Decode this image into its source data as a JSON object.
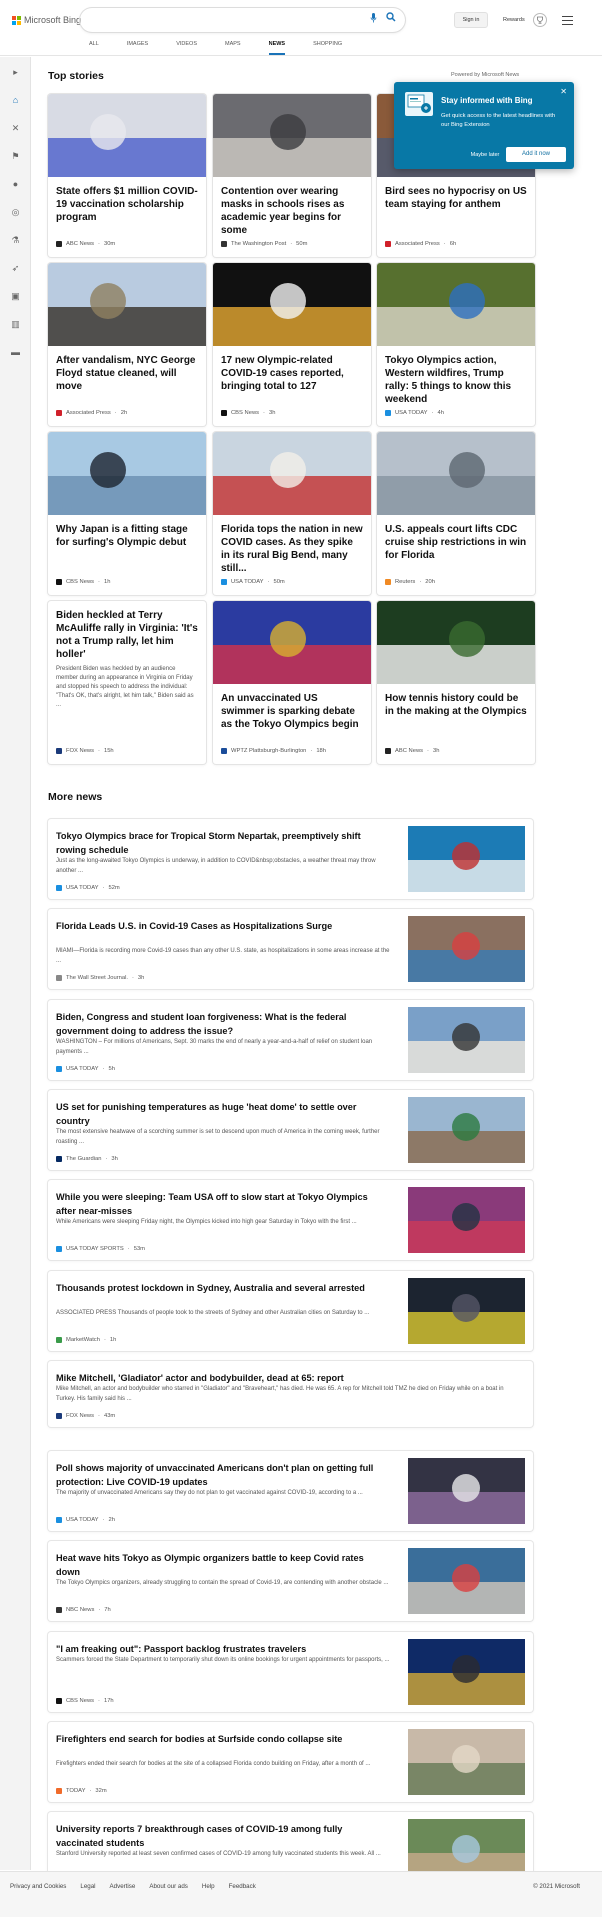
{
  "header": {
    "brand": "Microsoft Bing",
    "sign_in": "Sign in",
    "rewards": "Rewards",
    "tabs": [
      "ALL",
      "IMAGES",
      "VIDEOS",
      "MAPS",
      "NEWS",
      "SHOPPING"
    ],
    "active_tab": "NEWS"
  },
  "top_stories": {
    "heading": "Top stories",
    "powered_by": "Powered by Microsoft News",
    "cards": [
      {
        "title": "State offers $1 million COVID-19 vaccination scholarship program",
        "source": "ABC News",
        "time": "30m",
        "icon_color": "#222"
      },
      {
        "title": "Contention over wearing masks in schools rises as academic year begins for some",
        "source": "The Washington Post",
        "time": "50m",
        "icon_color": "#333"
      },
      {
        "title": "Bird sees no hypocrisy on US team staying for anthem",
        "source": "Associated Press",
        "time": "6h",
        "icon_color": "#d0202a"
      },
      {
        "title": "After vandalism, NYC George Floyd statue cleaned, will move",
        "source": "Associated Press",
        "time": "2h",
        "icon_color": "#d0202a"
      },
      {
        "title": "17 new Olympic-related COVID-19 cases reported, bringing total to 127",
        "source": "CBS News",
        "time": "3h",
        "icon_color": "#111"
      },
      {
        "title": "Tokyo Olympics action, Western wildfires, Trump rally: 5 things to know this weekend",
        "source": "USA TODAY",
        "time": "4h",
        "icon_color": "#1a8fe0"
      },
      {
        "title": "Why Japan is a fitting stage for surfing's Olympic debut",
        "source": "CBS News",
        "time": "1h",
        "icon_color": "#111"
      },
      {
        "title": "Florida tops the nation in new COVID cases. As they spike in its rural Big Bend, many still...",
        "source": "USA TODAY",
        "time": "50m",
        "icon_color": "#1a8fe0"
      },
      {
        "title": "U.S. appeals court lifts CDC cruise ship restrictions in win for Florida",
        "source": "Reuters",
        "time": "20h",
        "icon_color": "#f08a24"
      },
      {
        "title": "Biden heckled at Terry McAuliffe rally in Virginia: 'It's not a Trump rally, let him holler'",
        "description": "President Biden was heckled by an audience member during an appearance in Virginia on Friday and stopped his speech to address the individual: \"That's OK, that's alright, let him talk,\" Biden said as ...",
        "source": "FOX News",
        "time": "15h",
        "icon_color": "#1b3a7a"
      },
      {
        "title": "An unvaccinated US swimmer is sparking debate as the Tokyo Olympics begin",
        "source": "WPTZ Plattsburgh-Burlington",
        "time": "18h",
        "icon_color": "#1b4d9a"
      },
      {
        "title": "How tennis history could be in the making at the Olympics",
        "source": "ABC News",
        "time": "3h",
        "icon_color": "#222"
      }
    ]
  },
  "popup": {
    "title": "Stay informed with Bing",
    "description": "Get quick access to the latest headlines with our Bing Extension",
    "maybe_later": "Maybe later",
    "add_now": "Add it now"
  },
  "more_news": {
    "heading": "More news",
    "items": [
      {
        "title": "Tokyo Olympics brace for Tropical Storm Nepartak, preemptively shift rowing schedule",
        "description": "Just as the long-awaited Tokyo Olympics is underway, in addition to COVID&nbsp;obstacles, a weather threat may throw another ...",
        "source": "USA TODAY",
        "time": "52m",
        "icon_color": "#1a8fe0"
      },
      {
        "title": "Florida Leads U.S. in Covid-19 Cases as Hospitalizations Surge",
        "description": "MIAMI—Florida is recording more Covid-19 cases than any other U.S. state, as hospitalizations in some areas increase at the ...",
        "source": "The Wall Street Journal.",
        "time": "3h",
        "icon_color": "#888"
      },
      {
        "title": "Biden, Congress and student loan forgiveness: What is the federal government doing to address the issue?",
        "description": "WASHINGTON – For millions of Americans, Sept. 30 marks the end of nearly a year-and-a-half of relief on student loan payments ...",
        "source": "USA TODAY",
        "time": "5h",
        "icon_color": "#1a8fe0"
      },
      {
        "title": "US set for punishing temperatures as huge 'heat dome' to settle over country",
        "description": "The most extensive heatwave of a scorching summer is set to descend upon much of America in the coming week, further roasting ...",
        "source": "The Guardian",
        "time": "3h",
        "icon_color": "#052962"
      },
      {
        "title": "While you were sleeping: Team USA off to slow start at Tokyo Olympics after near-misses",
        "description": "While Americans were sleeping Friday night, the Olympics kicked into high gear Saturday in Tokyo with the first ...",
        "source": "USA TODAY SPORTS",
        "time": "53m",
        "icon_color": "#1a8fe0"
      },
      {
        "title": "Thousands protest lockdown in Sydney, Australia and several arrested",
        "description": "ASSOCIATED PRESS Thousands of people took to the streets of Sydney and other Australian cities on Saturday to ...",
        "source": "MarketWatch",
        "time": "1h",
        "icon_color": "#3a9b4a"
      },
      {
        "title": "Mike Mitchell, 'Gladiator' actor and bodybuilder, dead at 65: report",
        "description": "Mike Mitchell, an actor and bodybuilder who starred in \"Gladiator\" and \"Braveheart,\" has died. He was 65. A rep for Mitchell told TMZ he died on Friday while on a boat in Turkey. His family said his ...",
        "source": "FOX News",
        "time": "43m",
        "icon_color": "#1b3a7a"
      },
      {
        "title": "Poll shows majority of unvaccinated Americans don't plan on getting full protection: Live COVID-19 updates",
        "description": "The majority of unvaccinated Americans say they do not plan to get vaccinated against COVID-19, according to a ...",
        "source": "USA TODAY",
        "time": "2h",
        "icon_color": "#1a8fe0"
      },
      {
        "title": "Heat wave hits Tokyo as Olympic organizers battle to keep Covid rates down",
        "description": "The Tokyo Olympics organizers, already struggling to contain the spread of Covid-19, are contending with another obstacle ...",
        "source": "NBC News",
        "time": "7h",
        "icon_color": "#333"
      },
      {
        "title": "\"I am freaking out\": Passport backlog frustrates travelers",
        "description": "Scammers forced the State Department to temporarily shut down its online bookings for urgent appointments for passports, ...",
        "source": "CBS News",
        "time": "17h",
        "icon_color": "#111"
      },
      {
        "title": "Firefighters end search for bodies at Surfside condo collapse site",
        "description": "Firefighters ended their search for bodies at the site of a collapsed Florida condo building on Friday, after a month of ...",
        "source": "TODAY",
        "time": "32m",
        "icon_color": "#f06b2a"
      },
      {
        "title": "University reports 7 breakthrough cases of COVID-19 among fully vaccinated students",
        "description": "Stanford University reported at least seven confirmed cases of COVID-19 among fully vaccinated students this week. All ...",
        "source": "ABC News",
        "time": "15h",
        "icon_color": "#222"
      }
    ]
  },
  "footer": {
    "links": [
      "Privacy and Cookies",
      "Legal",
      "Advertise",
      "About our ads",
      "Help",
      "Feedback"
    ],
    "copyright": "© 2021 Microsoft"
  }
}
